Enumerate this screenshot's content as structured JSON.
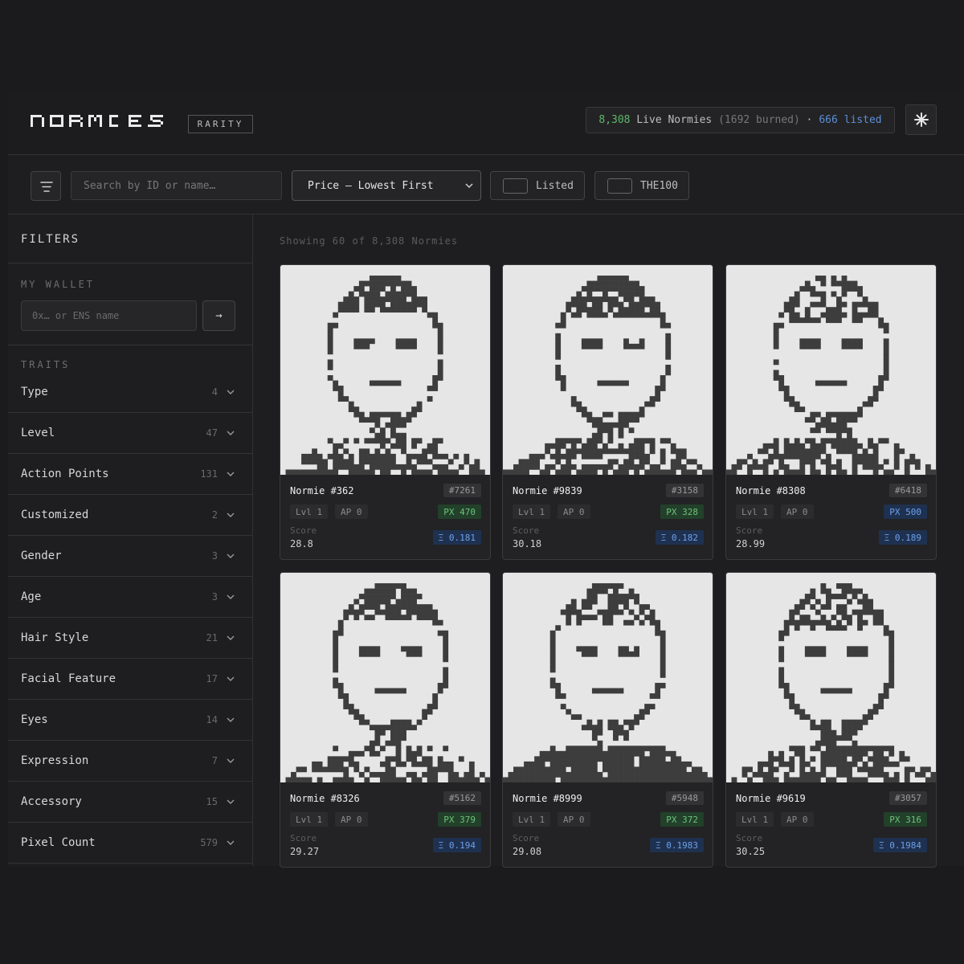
{
  "header": {
    "logo_text": "NORMIES",
    "badge": "RARITY",
    "stats": {
      "live_count": "8,308",
      "live_label": " Live Normies ",
      "burned": "(1692 burned)",
      "sep": " · ",
      "listed": "666 listed"
    },
    "action_icon": "sparkle-icon"
  },
  "toolbar": {
    "filter_icon": "filter-lines-icon",
    "search_placeholder": "Search by ID or name…",
    "sort_value": "Price — Lowest First",
    "toggle_listed": "Listed",
    "toggle_the100": "THE100"
  },
  "sidebar": {
    "title": "FILTERS",
    "wallet_label": "MY WALLET",
    "wallet_placeholder": "0x… or ENS name",
    "wallet_go": "→",
    "traits_label": "TRAITS",
    "traits": [
      {
        "name": "Type",
        "count": "4"
      },
      {
        "name": "Level",
        "count": "47"
      },
      {
        "name": "Action Points",
        "count": "131"
      },
      {
        "name": "Customized",
        "count": "2"
      },
      {
        "name": "Gender",
        "count": "3"
      },
      {
        "name": "Age",
        "count": "3"
      },
      {
        "name": "Hair Style",
        "count": "21"
      },
      {
        "name": "Facial Feature",
        "count": "17"
      },
      {
        "name": "Eyes",
        "count": "14"
      },
      {
        "name": "Expression",
        "count": "7"
      },
      {
        "name": "Accessory",
        "count": "15"
      },
      {
        "name": "Pixel Count",
        "count": "579"
      }
    ]
  },
  "main": {
    "showing": "Showing 60 of 8,308 Normies",
    "cards": [
      {
        "name": "Normie #362",
        "rank": "#7261",
        "lvl": "Lvl 1",
        "ap": "AP 0",
        "px": "PX 470",
        "px_color": "green",
        "score_label": "Score",
        "score": "28.8",
        "price": "Ξ 0.181"
      },
      {
        "name": "Normie #9839",
        "rank": "#3158",
        "lvl": "Lvl 1",
        "ap": "AP 0",
        "px": "PX 328",
        "px_color": "green",
        "score_label": "Score",
        "score": "30.18",
        "price": "Ξ 0.182"
      },
      {
        "name": "Normie #8308",
        "rank": "#6418",
        "lvl": "Lvl 1",
        "ap": "AP 0",
        "px": "PX 500",
        "px_color": "blue",
        "score_label": "Score",
        "score": "28.99",
        "price": "Ξ 0.189"
      },
      {
        "name": "Normie #8326",
        "rank": "#5162",
        "lvl": "Lvl 1",
        "ap": "AP 0",
        "px": "PX 379",
        "px_color": "green",
        "score_label": "Score",
        "score": "29.27",
        "price": "Ξ 0.194"
      },
      {
        "name": "Normie #8999",
        "rank": "#5948",
        "lvl": "Lvl 1",
        "ap": "AP 0",
        "px": "PX 372",
        "px_color": "green",
        "score_label": "Score",
        "score": "29.08",
        "price": "Ξ 0.1983"
      },
      {
        "name": "Normie #9619",
        "rank": "#3057",
        "lvl": "Lvl 1",
        "ap": "AP 0",
        "px": "PX 316",
        "px_color": "green",
        "score_label": "Score",
        "score": "30.25",
        "price": "Ξ 0.1984"
      }
    ]
  },
  "colors": {
    "green": "#6ec27a",
    "blue": "#6ea0e8",
    "pixel_dark": "#3d3d3d",
    "pixel_light": "#e6e6e6"
  }
}
